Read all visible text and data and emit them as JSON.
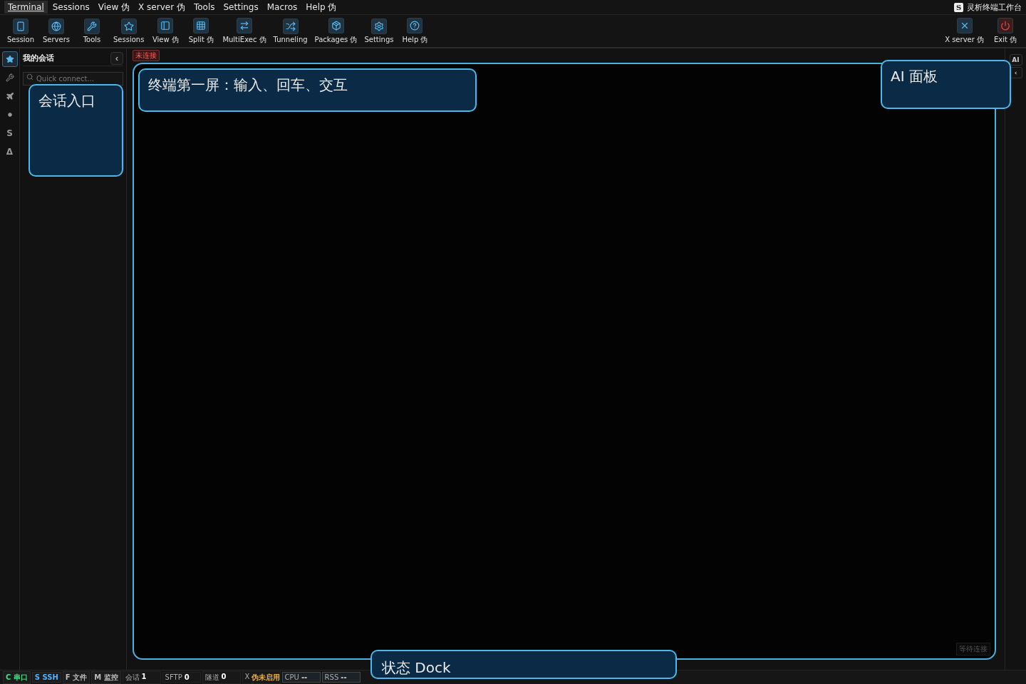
{
  "menu": [
    {
      "label": "Terminal",
      "selected": true
    },
    {
      "label": "Sessions",
      "selected": false
    },
    {
      "label": "View 伪",
      "selected": false
    },
    {
      "label": "X server 伪",
      "selected": false
    },
    {
      "label": "Tools",
      "selected": false
    },
    {
      "label": "Settings",
      "selected": false
    },
    {
      "label": "Macros",
      "selected": false
    },
    {
      "label": "Help 伪",
      "selected": false
    }
  ],
  "app": {
    "logo": "S",
    "title": "灵析终端工作台"
  },
  "toolbar": [
    {
      "kind": "session",
      "label": "Session"
    },
    {
      "kind": "servers",
      "label": "Servers"
    },
    {
      "kind": "tools",
      "label": "Tools"
    },
    {
      "kind": "sessions",
      "label": "Sessions"
    },
    {
      "kind": "view",
      "label": "View 伪"
    },
    {
      "kind": "split",
      "label": "Split 伪"
    },
    {
      "kind": "multiexec",
      "label": "MultiExec 伪"
    },
    {
      "kind": "tunneling",
      "label": "Tunneling"
    },
    {
      "kind": "packages",
      "label": "Packages 伪"
    },
    {
      "kind": "settings",
      "label": "Settings"
    },
    {
      "kind": "help",
      "label": "Help 伪"
    }
  ],
  "toolbar_right": [
    {
      "kind": "xserver",
      "label": "X server 伪"
    },
    {
      "kind": "exit",
      "label": "Exit 伪"
    }
  ],
  "rail": [
    {
      "kind": "star",
      "selected": true
    },
    {
      "kind": "tools",
      "selected": false
    },
    {
      "kind": "plane",
      "selected": false
    },
    {
      "kind": "dot",
      "selected": false
    },
    {
      "kind": "glyph",
      "text": "S",
      "selected": false
    },
    {
      "kind": "glyph",
      "text": "Δ",
      "selected": false
    }
  ],
  "sidebar": {
    "title": "我的会话",
    "collapse": "‹",
    "search": {
      "placeholder": "Quick connect..."
    }
  },
  "terminal": {
    "status": "未连接",
    "waiting": "等待连接"
  },
  "right_rail": [
    "AI",
    "‹"
  ],
  "callouts": [
    {
      "kind": "sidebar",
      "text": "会话入口"
    },
    {
      "kind": "terminal",
      "text": "终端第一屏：输入、回车、交互"
    },
    {
      "kind": "ai",
      "text": "AI 面板"
    },
    {
      "kind": "dock",
      "text": "状态 Dock"
    }
  ],
  "status_bar": [
    {
      "kind": "tag",
      "key": "C",
      "label": "串口",
      "color": "#3ddc84"
    },
    {
      "kind": "tag",
      "key": "S",
      "label": "SSH",
      "color": "#4fb3ff"
    },
    {
      "kind": "tag",
      "key": "F",
      "label": "文件",
      "color": "#bbbbbb"
    },
    {
      "kind": "tag",
      "key": "M",
      "label": "监控",
      "color": "#bbbbbb"
    },
    {
      "kind": "metric",
      "label": "会话",
      "value": "1",
      "color": "#ffffff"
    },
    {
      "kind": "metric",
      "label": "SFTP",
      "value": "0",
      "color": "#ffffff"
    },
    {
      "kind": "metric",
      "label": "隧道",
      "value": "0",
      "color": "#ffffff"
    },
    {
      "kind": "metric",
      "label": "X",
      "value": "伪未启用",
      "color": "#f0b040"
    },
    {
      "kind": "boxed",
      "label": "CPU",
      "value": "--"
    },
    {
      "kind": "boxed",
      "label": "RSS",
      "value": "--"
    }
  ]
}
